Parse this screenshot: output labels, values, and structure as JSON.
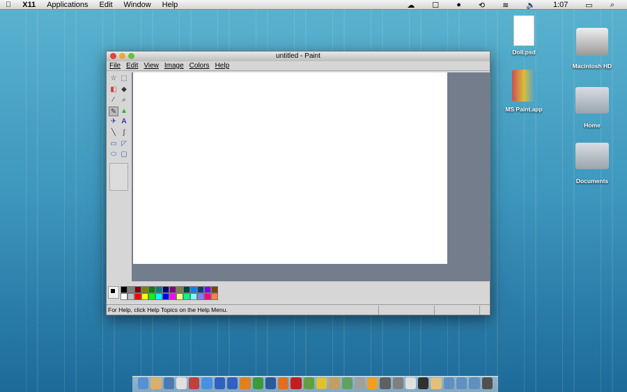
{
  "menubar": {
    "apple": "",
    "app": "X11",
    "items": [
      "Applications",
      "Edit",
      "Window",
      "Help"
    ],
    "clock": "1:07"
  },
  "window": {
    "title": "untitled - Paint",
    "menu": [
      "File",
      "Edit",
      "View",
      "Image",
      "Colors",
      "Help"
    ],
    "status": "For Help, click Help Topics on the Help Menu."
  },
  "palette": {
    "top": [
      "#000000",
      "#808080",
      "#800000",
      "#808000",
      "#008000",
      "#008080",
      "#000080",
      "#800080",
      "#808040",
      "#004040",
      "#0080ff",
      "#004080",
      "#8000ff",
      "#804000"
    ],
    "bottom": [
      "#ffffff",
      "#c0c0c0",
      "#ff0000",
      "#ffff00",
      "#00ff00",
      "#00ffff",
      "#0000ff",
      "#ff00ff",
      "#ffff80",
      "#00ff80",
      "#80ffff",
      "#8080ff",
      "#ff0080",
      "#ff8040"
    ]
  },
  "desktop": {
    "icons": [
      "Doll.psd",
      "Macintosh HD",
      "MS Paint.app",
      "Home",
      "Documents"
    ]
  },
  "dock_colors": [
    "#5a8fd0",
    "#d8b070",
    "#4a7ab0",
    "#e0e0e0",
    "#c04040",
    "#4a90e0",
    "#3060c0",
    "#3060c0",
    "#e08020",
    "#3c9a3c",
    "#2a5a9a",
    "#e07020",
    "#c02020",
    "#60a040",
    "#e0c030",
    "#c0a060",
    "#60a060",
    "#a0a0a0",
    "#f0a020",
    "#606060",
    "#808080",
    "#e0e0e0",
    "#303030",
    "#e0c080",
    "#6090c0",
    "#6090c0",
    "#6090c0",
    "#505050"
  ]
}
